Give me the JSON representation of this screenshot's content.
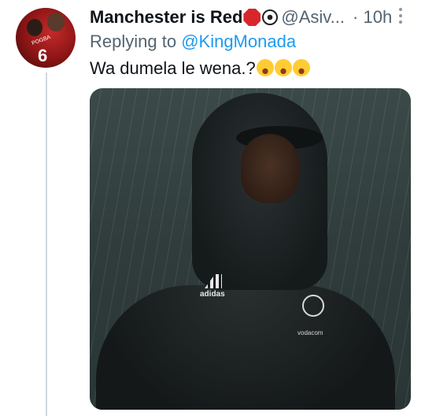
{
  "tweet": {
    "display_name": "Manchester is Red",
    "emojis": [
      "stop-sign-icon",
      "soccer-ball-icon"
    ],
    "handle": "@Asiv...",
    "separator": "·",
    "time": "10h",
    "replying_prefix": "Replying to ",
    "replying_to": "@KingMonada",
    "text": "Wa dumela le wena.?",
    "text_emojis": [
      "laughing-tears-icon",
      "laughing-tears-icon",
      "laughing-tears-icon"
    ]
  },
  "avatar": {
    "shirt_name": "POGBA",
    "shirt_number": "6"
  },
  "media": {
    "logo_text_1": "adidas",
    "logo_text_2": "vodacom"
  },
  "colors": {
    "text": "#0f1419",
    "secondary": "#536471",
    "link": "#1d9bf0",
    "thread_line": "#cfd9de"
  }
}
